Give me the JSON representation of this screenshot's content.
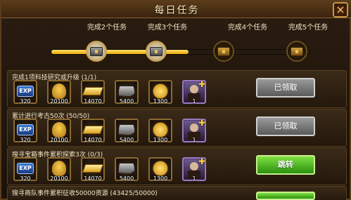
{
  "window": {
    "title": "每日任务",
    "close_label": "×"
  },
  "milestones": [
    {
      "label": "完成2个任务",
      "state": "claimed",
      "icon": "silver-chest-icon"
    },
    {
      "label": "完成3个任务",
      "state": "claimed",
      "icon": "silver-chest-icon"
    },
    {
      "label": "完成4个任务",
      "state": "locked",
      "icon": "gold-chest-icon"
    },
    {
      "label": "完成5个任务",
      "state": "locked",
      "icon": "gold-chest-icon"
    }
  ],
  "progress_fraction": 0.53,
  "rewards": [
    {
      "icon": "exp-icon",
      "icon_text": "EXP",
      "count": "320"
    },
    {
      "icon": "grain-icon",
      "count": "20100"
    },
    {
      "icon": "gold-bar-icon",
      "count": "14070"
    },
    {
      "icon": "iron-ore-icon",
      "count": "5400"
    },
    {
      "icon": "gold-coin-icon",
      "count": "1300"
    },
    {
      "icon": "hero-icon",
      "count": "1"
    }
  ],
  "tasks": [
    {
      "title": "完成1项科技研究或升级 (1/1)",
      "button": "已领取",
      "status": "claimed"
    },
    {
      "title": "累计进行考古50次 (50/50)",
      "button": "已领取",
      "status": "claimed"
    },
    {
      "title": "搜寻宝箱事件累积探索3次 (0/3)",
      "button": "跳转",
      "status": "go"
    },
    {
      "title": "搜寻商队事件累积征收50000资源 (43425/50000)",
      "button": "",
      "status": "go"
    }
  ],
  "colors": {
    "accent_gold": "#e8a800",
    "go_green": "#2a9010",
    "claimed_gray": "#5a5a5a"
  }
}
